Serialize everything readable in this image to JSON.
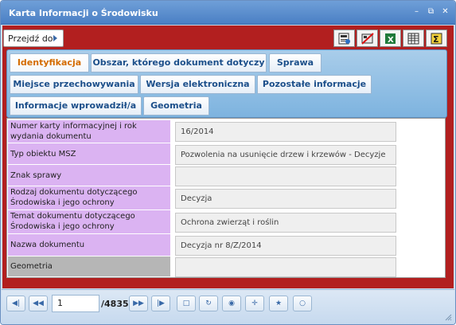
{
  "window": {
    "title": "Karta Informacji o Środowisku",
    "controls": [
      "minimize-icon",
      "restore-icon",
      "close-icon"
    ]
  },
  "toolbar": {
    "goto_label": "Przejdź do",
    "tools": [
      "report-icon",
      "no-map-icon",
      "excel-icon",
      "table-icon",
      "sigma-icon"
    ]
  },
  "tabs": [
    {
      "label": "Identyfikacja",
      "active": true
    },
    {
      "label": "Obszar, którego dokument dotyczy",
      "active": false
    },
    {
      "label": "Sprawa",
      "active": false
    },
    {
      "label": "Miejsce przechowywania",
      "active": false
    },
    {
      "label": "Wersja elektroniczna",
      "active": false
    },
    {
      "label": "Pozostałe informacje",
      "active": false
    },
    {
      "label": "Informacje wprowadził/a",
      "active": false
    },
    {
      "label": "Geometria",
      "active": false
    }
  ],
  "fields": [
    {
      "label": "Numer karty informacyjnej i rok wydania dokumentu",
      "value": "16/2014"
    },
    {
      "label": "Typ obiektu MSZ",
      "value": "Pozwolenia na usunięcie drzew i krzewów - Decyzje"
    },
    {
      "label": "Znak sprawy",
      "value": ""
    },
    {
      "label": "Rodzaj dokumentu dotyczącego Środowiska i jego ochrony",
      "value": "Decyzja"
    },
    {
      "label": "Temat dokumentu dotyczącego Środowiska i jego ochrony",
      "value": "Ochrona zwierząt i roślin"
    },
    {
      "label": "Nazwa dokumentu",
      "value": "Decyzja nr 8/Z/2014"
    },
    {
      "label": "Geometria",
      "value": ""
    }
  ],
  "pager": {
    "current_page": "1",
    "total": "/4835"
  },
  "colors": {
    "title_bar": "#4a7fc4",
    "red_frame": "#b21f1f",
    "label_bg": "#dbb3f2",
    "active_tab_text": "#d46c00"
  }
}
